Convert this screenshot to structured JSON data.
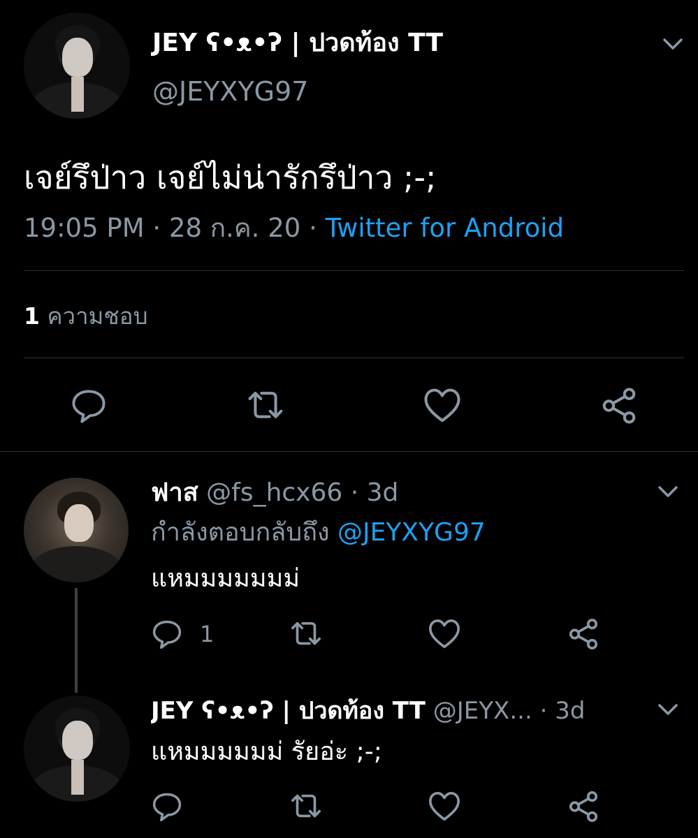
{
  "main_tweet": {
    "display_name": "JEY ʕ•ᴥ•ʔ | ปวดท้อง TT",
    "handle": "@JEYXYG97",
    "text": "เจย์รึป่าว เจย์ไม่น่ารักรึป่าว ;-;",
    "time": "19:05 PM",
    "date": "28 ก.ค. 20",
    "separator": "·",
    "source": "Twitter for Android",
    "likes_count": "1",
    "likes_label": "ความชอบ"
  },
  "reply_1": {
    "display_name": "ฟาส",
    "handle": "@fs_hcx66",
    "separator": "·",
    "age": "3d",
    "replying_to_label": "กำลังตอบกลับถึง",
    "replying_to_handle": "@JEYXYG97",
    "text": "แหมมมมมมม่",
    "reply_count": "1"
  },
  "reply_2": {
    "display_name": "JEY ʕ•ᴥ•ʔ | ปวดท้อง TT",
    "handle": "@JEYX...",
    "separator": "·",
    "age": "3d",
    "text": "แหมมมมมม่ รัยอ่ะ ;-;"
  },
  "icons": [
    "chevron-down-icon",
    "reply-icon",
    "retweet-icon",
    "heart-icon",
    "share-icon"
  ],
  "colors": {
    "background": "#000000",
    "text": "#ffffff",
    "secondary": "#8b98a5",
    "accent": "#1da1f2",
    "divider": "#2f3336"
  }
}
